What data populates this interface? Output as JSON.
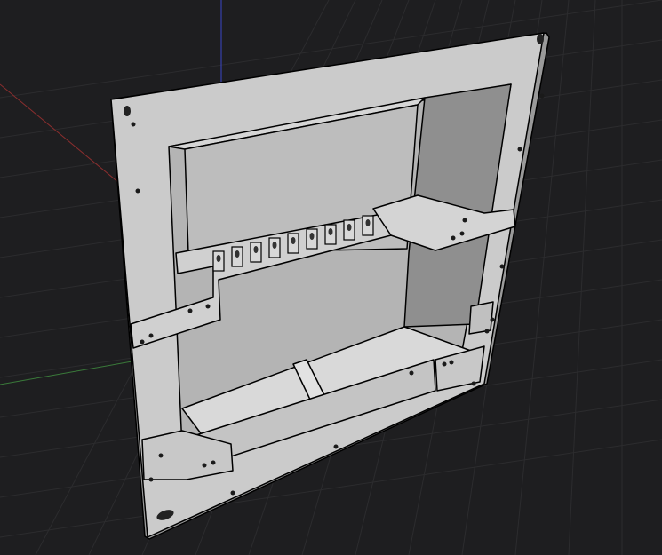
{
  "viewport": {
    "background_color": "#1e1e20",
    "grid_color": "#2c2c2e",
    "axis_x_color": "#8a2e2e",
    "axis_y_color": "#3a7a3a",
    "axis_z_color": "#3a46c8",
    "panel_color": "#c9c9c9",
    "panel_shadow_color": "#a8a8a8",
    "outline_color": "#000000"
  }
}
